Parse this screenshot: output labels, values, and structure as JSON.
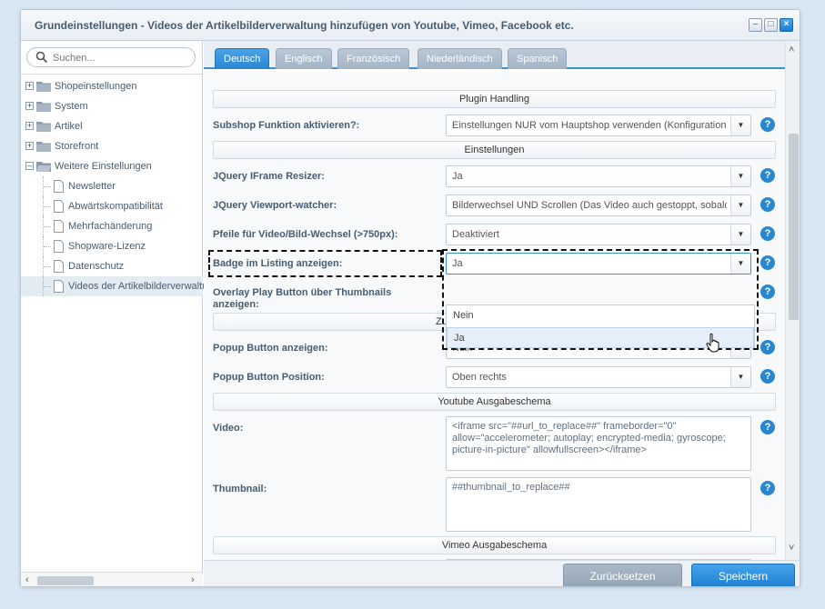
{
  "window": {
    "title": "Grundeinstellungen - Videos der Artikelbilderverwaltung hinzufügen von Youtube, Vimeo, Facebook etc.",
    "minimize": "–",
    "maximize": "□",
    "close": "×"
  },
  "sidebar": {
    "search_placeholder": "Suchen...",
    "nodes": [
      {
        "label": "Shopeinstellungen",
        "expander": "+"
      },
      {
        "label": "System",
        "expander": "+"
      },
      {
        "label": "Artikel",
        "expander": "+"
      },
      {
        "label": "Storefront",
        "expander": "+"
      },
      {
        "label": "Weitere Einstellungen",
        "expander": "–"
      }
    ],
    "children": [
      {
        "label": "Newsletter"
      },
      {
        "label": "Abwärtskompatibilität"
      },
      {
        "label": "Mehrfachänderung"
      },
      {
        "label": "Shopware-Lizenz"
      },
      {
        "label": "Datenschutz"
      },
      {
        "label": "Videos der Artikelbilderverwaltung"
      }
    ],
    "scroll_left": "‹",
    "scroll_right": "›"
  },
  "tabs": [
    {
      "label": "Deutsch",
      "active": true
    },
    {
      "label": "Englisch"
    },
    {
      "label": "Französisch"
    },
    {
      "label": "Niederländisch"
    },
    {
      "label": "Spanisch"
    }
  ],
  "sections": {
    "plugin_handling": "Plugin Handling",
    "einstellungen": "Einstellungen",
    "popup": "Zusätzlicher Popup Button",
    "youtube": "Youtube Ausgabeschema",
    "vimeo": "Vimeo Ausgabeschema"
  },
  "fields": {
    "subshop": {
      "label": "Subshop Funktion aktivieren?:",
      "value": "Einstellungen NUR vom Hauptshop verwenden (Konfiguratione"
    },
    "iframe_resizer": {
      "label": "JQuery IFrame Resizer:",
      "value": "Ja"
    },
    "viewport_watcher": {
      "label": "JQuery Viewport-watcher:",
      "value": "Bilderwechsel UND Scrollen (Das Video auch gestoppt, sobald"
    },
    "pfeile": {
      "label": "Pfeile für Video/Bild-Wechsel (>750px):",
      "value": "Deaktiviert"
    },
    "badge": {
      "label": "Badge im Listing anzeigen:",
      "value": "Ja"
    },
    "overlay": {
      "label": "Overlay Play Button über Thumbnails anzeigen:"
    },
    "popup_show": {
      "label": "Popup Button anzeigen:",
      "value": "Nein"
    },
    "popup_position": {
      "label": "Popup Button Position:",
      "value": "Oben rechts"
    },
    "video": {
      "label": "Video:",
      "value": "<iframe src=\"##url_to_replace##\" frameborder=\"0\" allow=\"accelerometer; autoplay; encrypted-media; gyroscope; picture-in-picture\" allowfullscreen></iframe>"
    },
    "thumbnail": {
      "label": "Thumbnail:",
      "value": "##thumbnail_to_replace##"
    }
  },
  "dropdown": {
    "options": [
      "Nein",
      "Ja"
    ],
    "highlighted": "Ja"
  },
  "help_glyph": "?",
  "combo_arrow": "▼",
  "scroll_up": "˄",
  "scroll_down": "˅",
  "buttons": {
    "reset": "Zurücksetzen",
    "save": "Speichern"
  },
  "colors": {
    "accent": "#2a86d1",
    "title_text": "#475c6f",
    "background": "#d9e7f4"
  }
}
